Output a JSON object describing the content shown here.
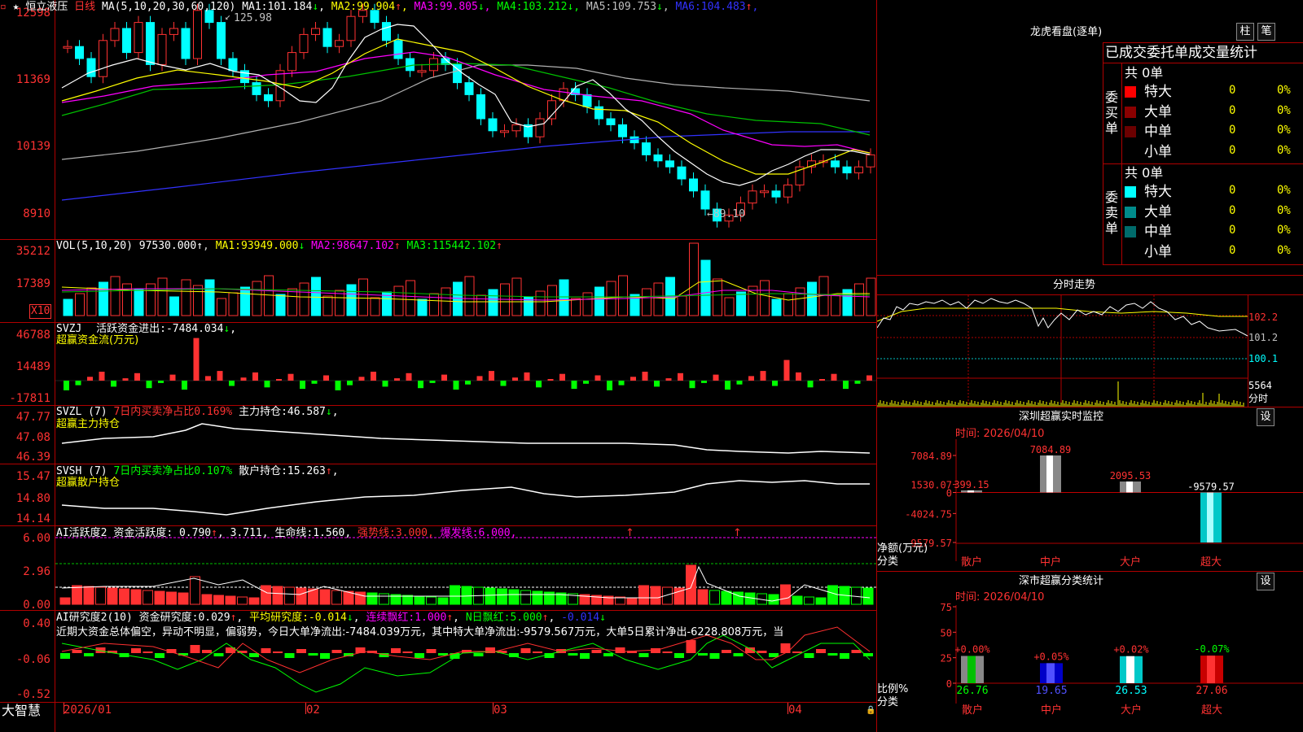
{
  "main": {
    "logo": "★",
    "name": "恒立液压",
    "period": "日线",
    "ma_label": "MA(5,10,20,30,60,120)",
    "ma_values": [
      {
        "name": "MA1:",
        "value": "101.184",
        "arrow": "↓",
        "color": "#ffffff"
      },
      {
        "name": "MA2:",
        "value": "99.904",
        "arrow": "↑",
        "color": "#ffff00"
      },
      {
        "name": "MA3:",
        "value": "99.805",
        "arrow": "↓",
        "color": "#ff00ff"
      },
      {
        "name": "MA4:",
        "value": "103.212",
        "arrow": "↓",
        "color": "#00ff00"
      },
      {
        "name": "MA5:",
        "value": "109.753",
        "arrow": "↓",
        "color": "#c0c0c0"
      },
      {
        "name": "MA6:",
        "value": "104.483",
        "arrow": "↑",
        "color": "#3232ff"
      }
    ],
    "y_ticks": [
      "12598",
      "11369",
      "10139",
      "8910"
    ],
    "high_mark": "125.98",
    "low_mark": "←89.10"
  },
  "vol": {
    "label": "VOL(5,10,20)",
    "value": "97530.000",
    "arrow": "↑",
    "ma": [
      {
        "name": "MA1:",
        "value": "93949.000",
        "arrow": "↓",
        "color": "#ffff00"
      },
      {
        "name": "MA2:",
        "value": "98647.102",
        "arrow": "↑",
        "color": "#ff00ff"
      },
      {
        "name": "MA3:",
        "value": "115442.102",
        "arrow": "↑",
        "color": "#00ff00"
      }
    ],
    "y_ticks": [
      "35212",
      "17389"
    ],
    "unit": "X10"
  },
  "svzj": {
    "label": "SVZJ",
    "desc": "活跃资金进出:",
    "value": "-7484.034",
    "arrow": "↓",
    "sub": "超赢资金流(万元)",
    "y_ticks": [
      "46788",
      "14489",
      "-17811"
    ]
  },
  "svzl": {
    "label": "SVZL (7)",
    "ratio_label": "7日内买卖净占比0.169%",
    "hold_label": "主力持仓:",
    "hold_value": "46.587",
    "arrow": "↓",
    "sub": "超赢主力持仓",
    "y_ticks": [
      "47.77",
      "47.08",
      "46.39"
    ]
  },
  "svsh": {
    "label": "SVSH (7)",
    "ratio_label": "7日内买卖净占比0.107%",
    "hold_label": "散户持仓:",
    "hold_value": "15.263",
    "arrow": "↑",
    "sub": "超赢散户持仓",
    "y_ticks": [
      "15.47",
      "14.80",
      "14.14"
    ]
  },
  "ai1": {
    "label": "AI活跃度2",
    "desc": "资金活跃度:",
    "v1": "0.790",
    "v2": "3.711",
    "life": "生命线:",
    "life_v": "1.560",
    "strong": "强势线:",
    "strong_v": "3.000",
    "burst": "爆发线:",
    "burst_v": "6.000",
    "y_ticks": [
      "6.00",
      "2.96",
      "0.00"
    ]
  },
  "ai2": {
    "label": "AI研究度2(10)",
    "desc": "资金研究度:",
    "v1": "0.029",
    "avg": "平均研究度:",
    "avg_v": "-0.014",
    "cont": "连续飘红:",
    "cont_v": "1.000",
    "n": "N日飘红:",
    "n_v": "5.000",
    "last": "-0.014",
    "comment": "近期大资金总体偏空，异动不明显，偏弱势，今日大单净流出:-7484.039万元，其中特大单净流出:-9579.567万元，大单5日累计净出-6228.808万元，当",
    "y_ticks": [
      "0.40",
      "-0.06",
      "-0.52"
    ]
  },
  "xaxis": {
    "brand": "大智慧",
    "labels": [
      "2026/01",
      "02",
      "03",
      "04"
    ]
  },
  "right": {
    "lhb_title": "龙虎看盘(逐单)",
    "btn_zhu": "柱",
    "btn_bi": "笔",
    "stat_title": "已成交委托单成交量统计",
    "buy_side": "委买单",
    "sell_side": "委卖单",
    "buy_total": "共 0单",
    "sell_total": "共 0单",
    "buy_rows": [
      {
        "name": "特大",
        "val": "0",
        "pct": "0%",
        "color": "#ff0000"
      },
      {
        "name": "大单",
        "val": "0",
        "pct": "0%",
        "color": "#8b0000"
      },
      {
        "name": "中单",
        "val": "0",
        "pct": "0%",
        "color": "#6b0000"
      },
      {
        "name": "小单",
        "val": "0",
        "pct": "0%",
        "color": "#000000"
      }
    ],
    "sell_rows": [
      {
        "name": "特大",
        "val": "0",
        "pct": "0%",
        "color": "#00ffff"
      },
      {
        "name": "大单",
        "val": "0",
        "pct": "0%",
        "color": "#008b8b"
      },
      {
        "name": "中单",
        "val": "0",
        "pct": "0%",
        "color": "#006b6b"
      },
      {
        "name": "小单",
        "val": "0",
        "pct": "0%",
        "color": "#000000"
      }
    ],
    "fenshi_title": "分时走势",
    "fenshi_prices": [
      "102.2",
      "101.2",
      "100.1"
    ],
    "fenshi_vol": "5564",
    "fenshi_unit": "分时",
    "monitor_title": "深圳超赢实时监控",
    "monitor_btn": "设",
    "monitor_time": "时间: 2026/04/10",
    "monitor_unit": "净额(万元)",
    "monitor_cat": "分类",
    "stat2_title": "深市超赢分类统计",
    "stat2_btn": "设",
    "stat2_time": "时间: 2026/04/10",
    "stat2_unit": "比例%",
    "stat2_cat": "分类"
  },
  "chart_data": [
    {
      "type": "bar",
      "title": "深圳超赢实时监控",
      "ylabel": "净额(万元)",
      "categories": [
        "散户",
        "中户",
        "大户",
        "超大"
      ],
      "values": [
        399.15,
        7084.89,
        2095.53,
        -9579.57
      ],
      "y_ticks": [
        "7084.89",
        "1530.07",
        "0",
        "-4024.75",
        "-9579.57"
      ],
      "ylim": [
        -9579.57,
        7084.89
      ]
    },
    {
      "type": "bar",
      "title": "深市超赢分类统计",
      "ylabel": "比例%",
      "categories": [
        "散户",
        "中户",
        "大户",
        "超大"
      ],
      "values": [
        26.76,
        19.65,
        26.53,
        27.06
      ],
      "changes": [
        "+0.00%",
        "+0.05%",
        "+0.02%",
        "-0.07%"
      ],
      "y_ticks": [
        "75",
        "50",
        "25",
        "0"
      ],
      "ylim": [
        0,
        75
      ]
    }
  ]
}
